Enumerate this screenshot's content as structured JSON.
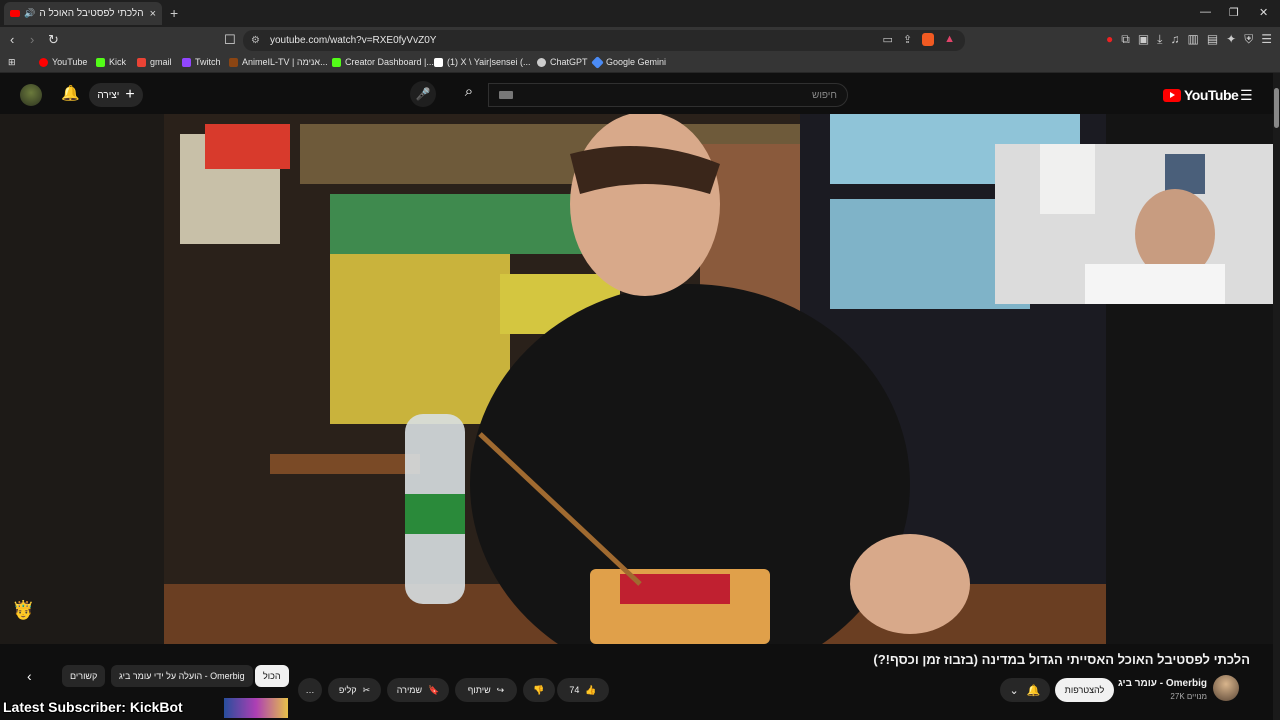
{
  "browser": {
    "tab_title": "הלכתי לפסטיבל האוכל האסיי…",
    "tab_close": "×",
    "new_tab": "+",
    "url": "youtube.com/watch?v=RXE0fyVvZ0Y",
    "window_controls": [
      "—",
      "❐",
      "✕"
    ]
  },
  "bookmarks": [
    {
      "label": "YouTube",
      "color": "#ff0000"
    },
    {
      "label": "Kick",
      "color": "#53fc18"
    },
    {
      "label": "gmail",
      "color": "#ea4335"
    },
    {
      "label": "Twitch",
      "color": "#9146ff"
    },
    {
      "label": "AnimeIL-TV | אנימה...",
      "color": "#8b4513"
    },
    {
      "label": "Creator Dashboard |...",
      "color": "#53fc18"
    },
    {
      "label": "(1) X \\ Yair|sensei (...",
      "color": "#ffffff"
    },
    {
      "label": "ChatGPT",
      "color": "#cccccc"
    },
    {
      "label": "Google Gemini",
      "color": "#4b8bf5"
    }
  ],
  "yt_header": {
    "create_label": "יצירה",
    "search_placeholder": "חיפוש",
    "logo_text": "YouTube"
  },
  "video": {
    "title": "הלכתי לפסטיבל האוכל האסייתי הגדול במדינה (בזבוז זמן וכסף!?)",
    "channel_name": "עומר ביג - Omerbig",
    "subscribers": "27K מנויים",
    "join_label": "להצטרפות",
    "like_count": "74",
    "share_label": "שיתוף",
    "save_label": "שמירה",
    "clip_label": "קליפ",
    "more_label": "…"
  },
  "chips": {
    "all": "הכול",
    "uploaded_by": "הועלה על ידי עומר ביג - Omerbig",
    "related": "קשורים"
  },
  "overlay": {
    "text": "Latest Subscriber: KickBot"
  },
  "colors": {
    "brand": "#ff0000",
    "background": "#0f0f0f",
    "pill": "#272727"
  }
}
